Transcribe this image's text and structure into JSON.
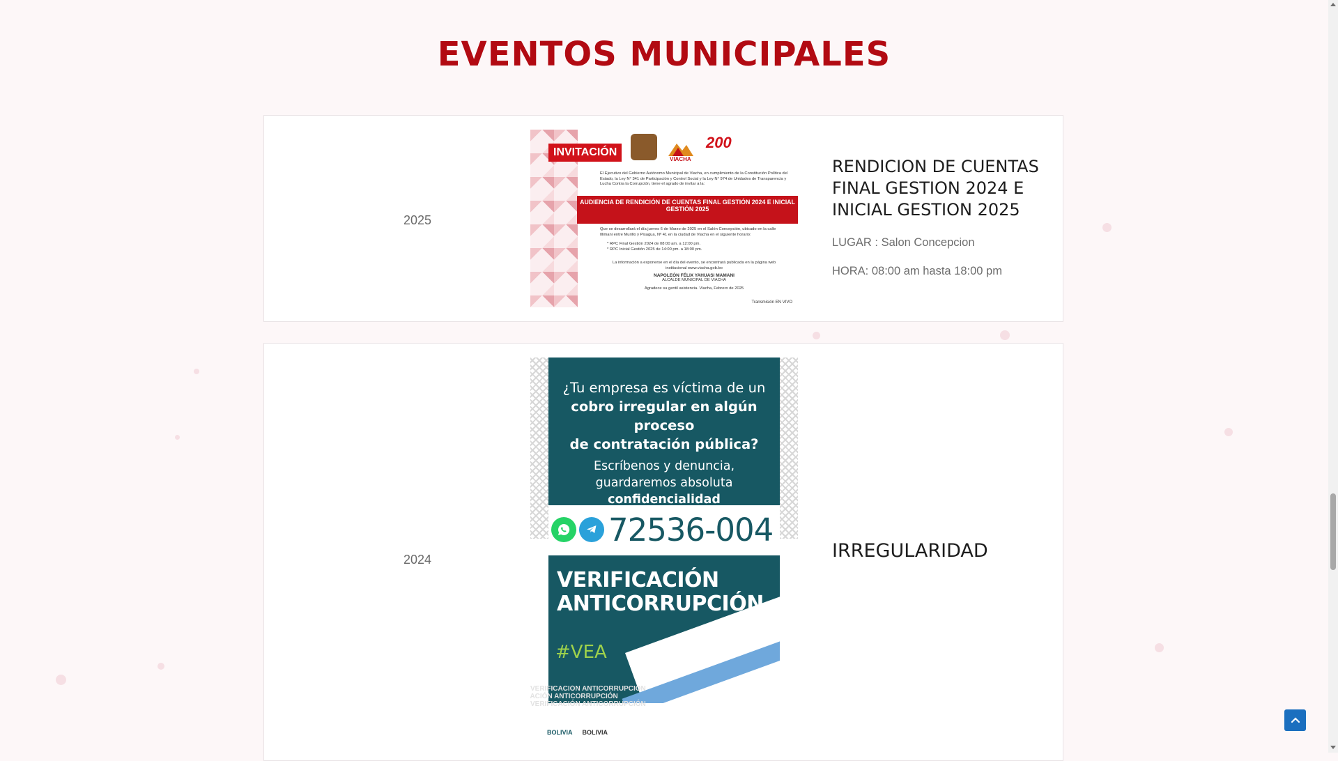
{
  "page": {
    "title": "EVENTOS MUNICIPALES"
  },
  "colors": {
    "title": "#b20a12",
    "accent_red": "#d1121a",
    "teal": "#175863",
    "green": "#9fd24b",
    "scroll_button": "#1b6fbf"
  },
  "events": [
    {
      "year": "2025",
      "title": "RENDICION DE CUENTAS FINAL GESTION 2024 E INICIAL GESTION 2025",
      "place": "LUGAR : Salon Concepcion",
      "time": "HORA: 08:00 am hasta 18:00 pm",
      "poster": {
        "badge": "INVITACIÓN",
        "logo_text": "VIACHA",
        "anniversary": "200",
        "intro": "El Ejecutivo del Gobierno Autónomo Municipal de Viacha, en cumplimiento de la Constitución Política del Estado, la Ley N° 341 de Participación y Control Social y la Ley N° 974 de Unidades de Transparencia y Lucha Contra la Corrupción, tiene el agrado de invitar a la:",
        "band": "AUDIENCIA DE RENDICIÓN DE CUENTAS FINAL GESTIÓN 2024 E INICIAL GESTIÓN 2025",
        "details": "Que se desarrollará el día jueves 6 de Marzo de 2025 en el Salón Concepción, ubicado en la calle Illimani entre Murillo y Pisagua, Nº 41 en la ciudad de Viacha en el siguiente horario:",
        "item1": "* RPC Final Gestión 2024 de 08:00 am. a 12:00 pm.",
        "item2": "* RPC Inicial Gestión 2025 de 14:00 pm. a 18:00 pm.",
        "note": "La información a exponerse en el día del evento, se encontrará publicada en la página web institucional www.viacha.gob.bo",
        "signer": "NAPOLEÓN FÉLIX YAHUASI MAMANI",
        "signer_role": "ALCALDE MUNICIPAL DE VIACHA",
        "closing": "Agradece su gentil asistencia. Viacha, Febrero de 2025",
        "footer": "Transmisión EN VIVO"
      }
    },
    {
      "year": "2024",
      "title": "IRREGULARIDAD",
      "poster": {
        "question_1": "¿Tu empresa es víctima de un",
        "question_2": "cobro irregular en algún proceso",
        "question_3": "de contratación pública?",
        "call_1": "Escríbenos y denuncia,",
        "call_2": "guardaremos absoluta",
        "call_3": "confidencialidad",
        "phone": "72536-004",
        "brand_1": "VERIFICACIÓN",
        "brand_2": "ANTICORRUPCIÓN",
        "hashtag": "#VEA",
        "watermark": "VERIFICACIÓN ANTICORRUPCIÓN",
        "logo_1": "BOLIVIA",
        "logo_2": "BOLIVIA"
      }
    }
  ],
  "icons": [
    "whatsapp-icon",
    "telegram-icon",
    "arrow-up-icon"
  ]
}
